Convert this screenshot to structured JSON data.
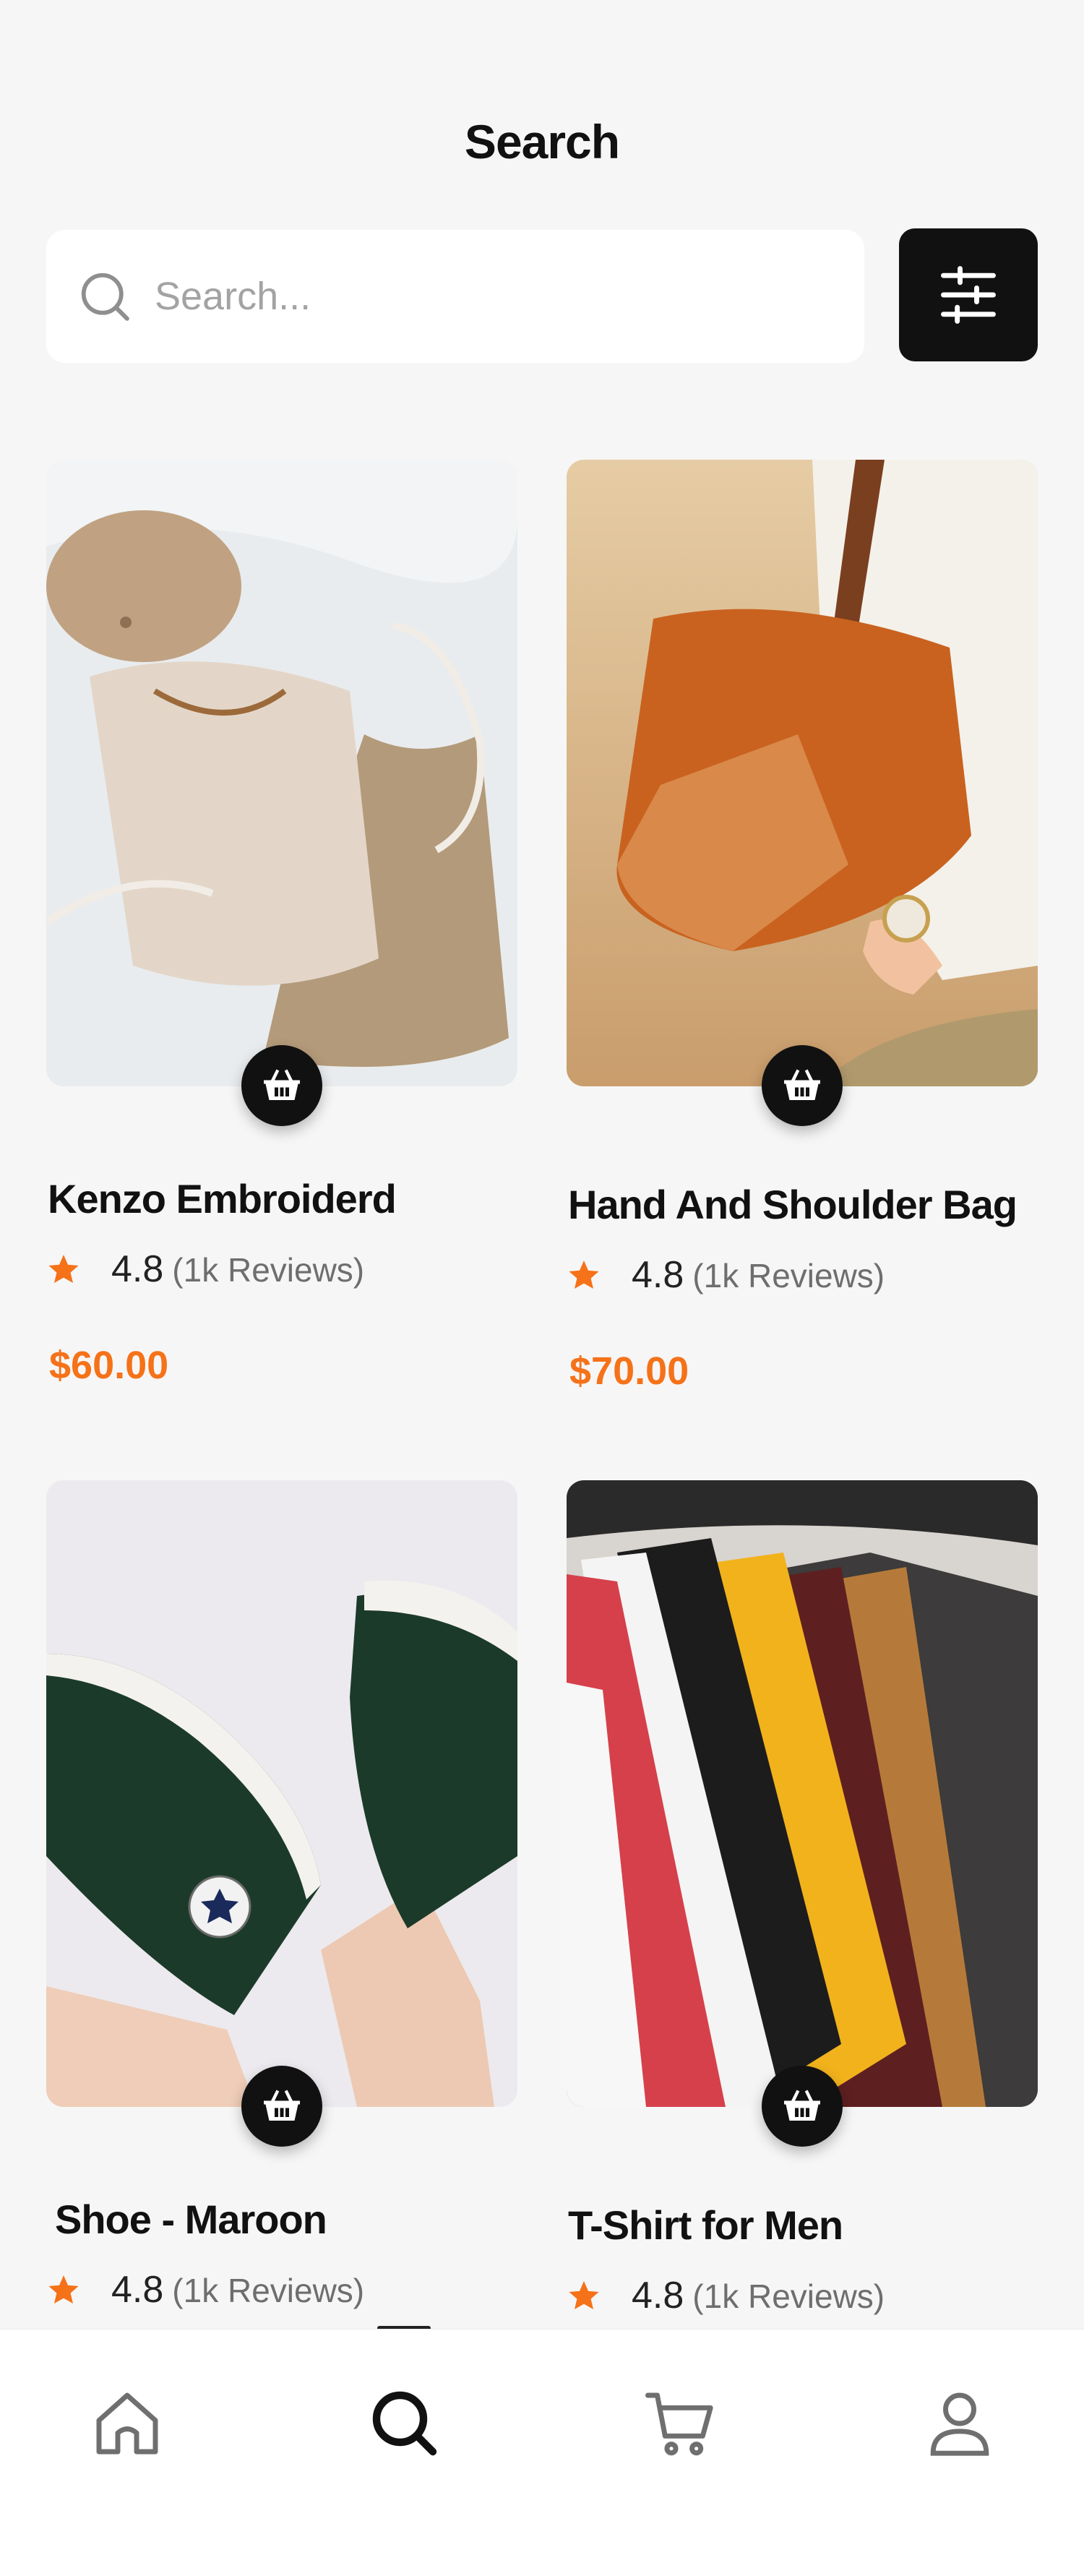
{
  "header": {
    "title": "Search"
  },
  "search": {
    "placeholder": "Search..."
  },
  "products": [
    {
      "name": "Kenzo Embroiderd",
      "rating": "4.8",
      "reviews": "(1k Reviews)",
      "price": "$60.00"
    },
    {
      "name": "Hand And Shoulder Bag",
      "rating": "4.8",
      "reviews": "(1k Reviews)",
      "price": "$70.00"
    },
    {
      "name": "Shoe - Maroon",
      "rating": "4.8",
      "reviews": "(1k Reviews)"
    },
    {
      "name": "T-Shirt for Men",
      "rating": "4.8",
      "reviews": "(1k Reviews)"
    }
  ],
  "bottom_nav": [
    {
      "icon": "home-icon",
      "active": false
    },
    {
      "icon": "search-icon",
      "active": true
    },
    {
      "icon": "cart-icon",
      "active": false
    },
    {
      "icon": "profile-icon",
      "active": false
    }
  ],
  "colors": {
    "accent": "#f57219",
    "dark": "#111111",
    "background": "#f6f6f6"
  }
}
